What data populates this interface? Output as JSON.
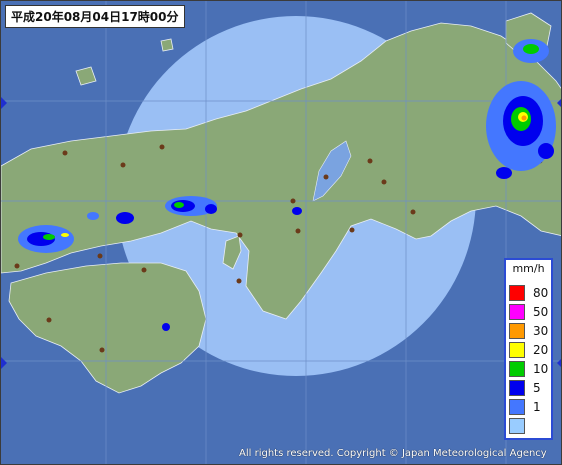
{
  "header": {
    "timestamp": "平成20年08月04日17時00分"
  },
  "legend": {
    "unit": "mm/h",
    "items": [
      {
        "label": "80",
        "color": "#ff0000"
      },
      {
        "label": "50",
        "color": "#ff00ff"
      },
      {
        "label": "30",
        "color": "#ff9900"
      },
      {
        "label": "20",
        "color": "#ffff00"
      },
      {
        "label": "10",
        "color": "#00cc00"
      },
      {
        "label": "5",
        "color": "#0000ee"
      },
      {
        "label": "1",
        "color": "#4477ff"
      },
      {
        "label": "",
        "color": "#99ccff"
      }
    ]
  },
  "footer": {
    "copyright": "All rights reserved. Copyright © Japan Meteorological Agency"
  },
  "colors": {
    "sea": "#4a70b5",
    "land": "#8aa877",
    "radar_range": "#a8ccff",
    "grid": "#6e8fc8"
  }
}
